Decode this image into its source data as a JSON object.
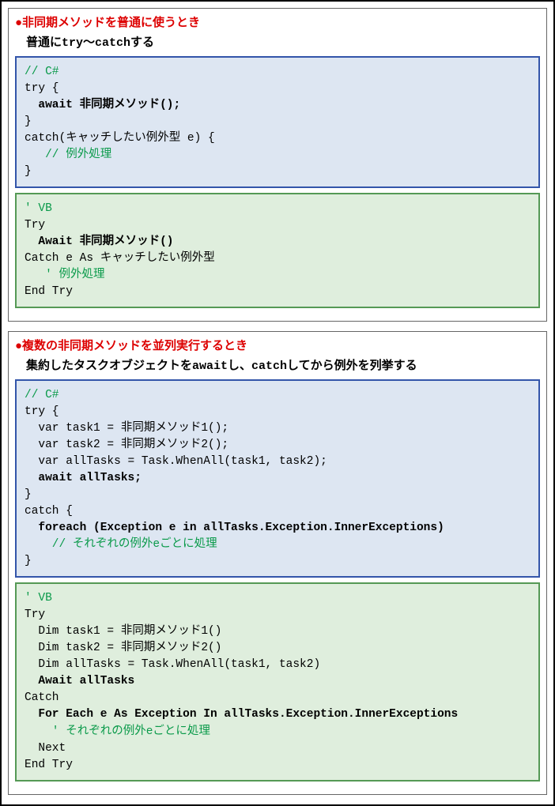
{
  "sections": [
    {
      "bullet": "●",
      "title": "非同期メソッドを普通に使うとき",
      "subtitle": "普通にtry〜catchする",
      "csharp": {
        "l1": "// C#",
        "l2": "try {",
        "l3": "  await 非同期メソッド();",
        "l4": "}",
        "l5": "catch(キャッチしたい例外型 e) {",
        "l6": "   // 例外処理",
        "l7": "}"
      },
      "vb": {
        "l1": "' VB",
        "l2": "Try",
        "l3": "  Await 非同期メソッド()",
        "l4": "Catch e As キャッチしたい例外型",
        "l5": "   ' 例外処理",
        "l6": "End Try"
      }
    },
    {
      "bullet": "●",
      "title": "複数の非同期メソッドを並列実行するとき",
      "subtitle": "集約したタスクオブジェクトをawaitし、catchしてから例外を列挙する",
      "csharp": {
        "l1": "// C#",
        "l2": "try {",
        "l3": "  var task1 = 非同期メソッド1();",
        "l4": "  var task2 = 非同期メソッド2();",
        "l5": "  var allTasks = Task.WhenAll(task1, task2);",
        "l6": "  await allTasks;",
        "l7": "}",
        "l8": "catch {",
        "l9": "  foreach (Exception e in allTasks.Exception.InnerExceptions)",
        "l10": "    // それぞれの例外eごとに処理",
        "l11": "}"
      },
      "vb": {
        "l1": "' VB",
        "l2": "Try",
        "l3": "  Dim task1 = 非同期メソッド1()",
        "l4": "  Dim task2 = 非同期メソッド2()",
        "l5": "  Dim allTasks = Task.WhenAll(task1, task2)",
        "l6": "  Await allTasks",
        "l7": "Catch",
        "l8": "  For Each e As Exception In allTasks.Exception.InnerExceptions",
        "l9": "    ' それぞれの例外eごとに処理",
        "l10": "  Next",
        "l11": "End Try"
      }
    }
  ]
}
